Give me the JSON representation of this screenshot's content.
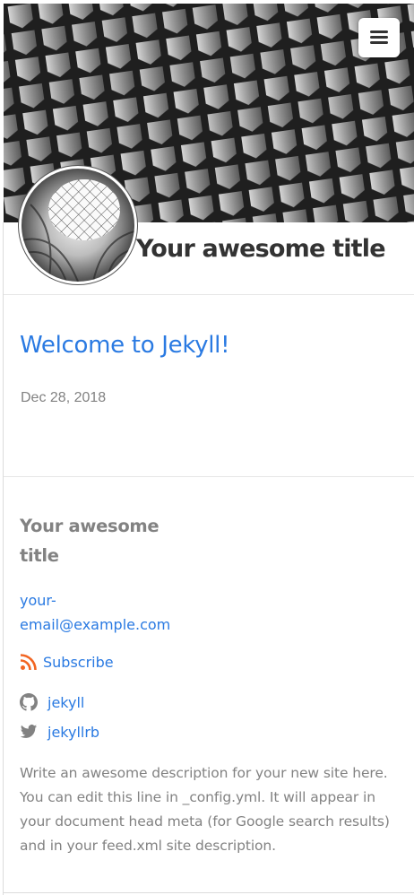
{
  "header": {
    "site_title": "Your awesome title",
    "menu_icon": "hamburger-menu-icon"
  },
  "post": {
    "title": "Welcome to Jekyll!",
    "date": "Dec 28, 2018"
  },
  "footer": {
    "title": "Your awesome title",
    "email": "your-email@example.com",
    "email_line1": "your-",
    "email_line2": "email@example.com",
    "subscribe_label": "Subscribe",
    "github_label": "jekyll",
    "twitter_label": "jekyllrb",
    "description": "Write an awesome description for your new site here. You can edit this line in _config.yml. It will appear in your document head meta (for Google search results) and in your feed.xml site description."
  },
  "colors": {
    "link": "#2a7ae2",
    "rss": "#f26522",
    "muted": "#828282",
    "title": "#333333"
  },
  "icons": [
    "rss-icon",
    "github-icon",
    "twitter-icon",
    "hamburger-menu-icon"
  ]
}
